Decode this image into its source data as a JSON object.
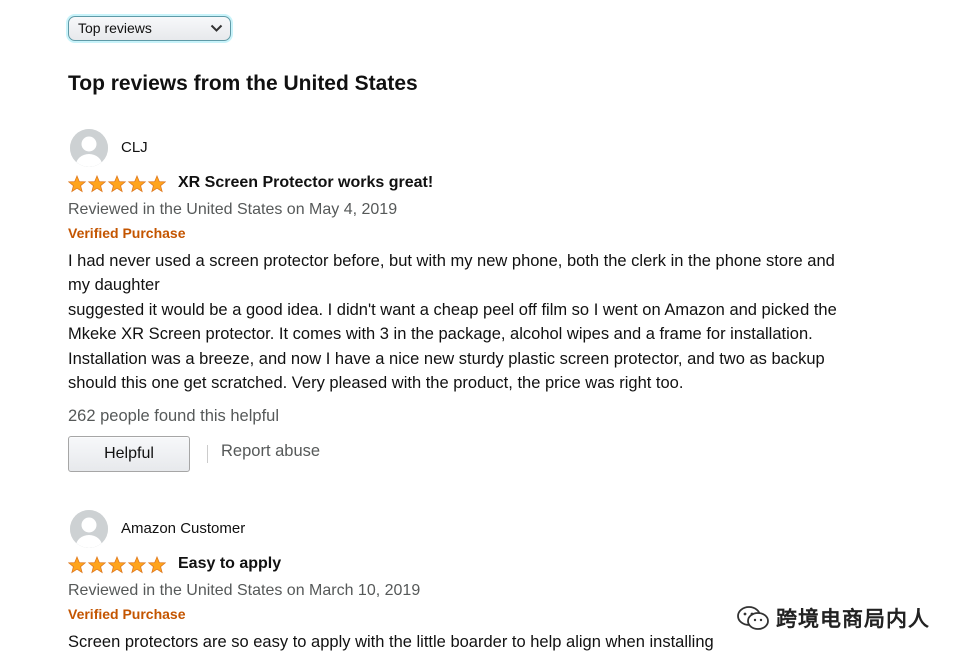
{
  "sort": {
    "selected": "Top reviews"
  },
  "section_title": "Top reviews from the United States",
  "colors": {
    "star": "#ffa41c",
    "verified": "#c45500",
    "muted_text": "#565959"
  },
  "reviews": [
    {
      "profile_name": "CLJ",
      "rating": 5,
      "title": "XR Screen Protector works great!",
      "date": "Reviewed in the United States on May 4, 2019",
      "verified": "Verified Purchase",
      "body": "I had never used a screen protector before, but with my new phone, both the clerk in the phone store and\nmy daughter\nsuggested it would be a good idea. I didn't want a cheap peel off film so I went on Amazon and picked the\nMkeke XR Screen protector. It comes with 3 in the package, alcohol wipes and a frame for installation.\nInstallation was a breeze, and now I have a nice new sturdy plastic screen protector, and two as backup\nshould this one get scratched. Very pleased with the product, the price was right too.",
      "helpful_count": "262 people found this helpful",
      "helpful_button": "Helpful",
      "report": "Report abuse"
    },
    {
      "profile_name": "Amazon Customer",
      "rating": 5,
      "title": "Easy to apply",
      "date": "Reviewed in the United States on March 10, 2019",
      "verified": "Verified Purchase",
      "body": "Screen protectors are so easy to apply with the little boarder to help align when installing"
    }
  ],
  "watermark": {
    "text": "跨境电商局内人",
    "icon": "wechat-logo-icon"
  }
}
